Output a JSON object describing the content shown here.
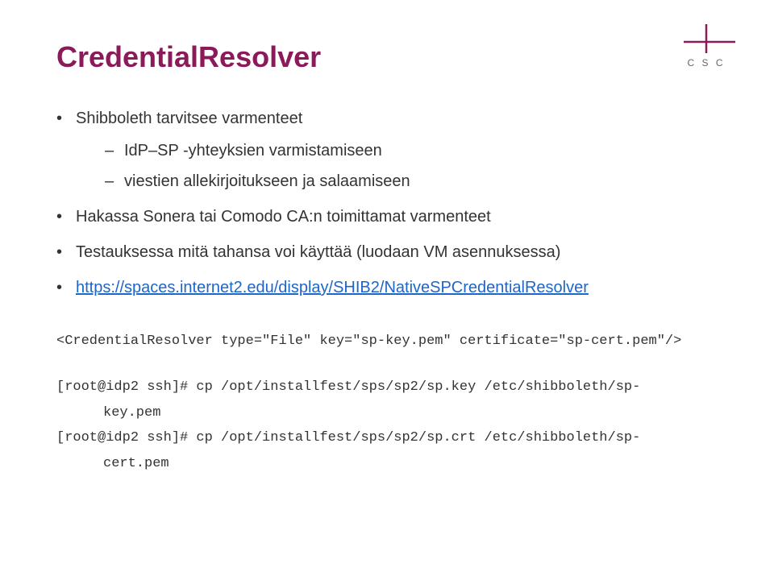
{
  "title": "CredentialResolver",
  "bullets": {
    "b1": "Shibboleth tarvitsee varmenteet",
    "b1a": "IdP–SP -yhteyksien varmistamiseen",
    "b1b": "viestien allekirjoitukseen ja salaamiseen",
    "b2": "Hakassa Sonera tai Comodo CA:n toimittamat varmenteet",
    "b3": "Testauksessa mitä tahansa voi käyttää (luodaan VM asennuksessa)",
    "b4_link": "https://spaces.internet2.edu/display/SHIB2/NativeSPCredentialResolver"
  },
  "code": {
    "line1": "<CredentialResolver type=\"File\" key=\"sp-key.pem\" certificate=\"sp-cert.pem\"/>",
    "line2a": "[root@idp2 ssh]# cp /opt/installfest/sps/sp2/sp.key /etc/shibboleth/sp-",
    "line2b": "key.pem",
    "line3a": "[root@idp2 ssh]# cp /opt/installfest/sps/sp2/sp.crt /etc/shibboleth/sp-",
    "line3b": "cert.pem"
  },
  "logo_text": "C S C"
}
